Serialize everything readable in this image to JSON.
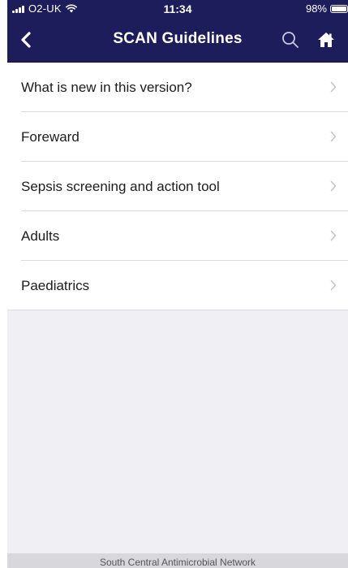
{
  "status_bar": {
    "carrier": "O2-UK",
    "time": "11:34",
    "battery_percent": "98%",
    "battery_level": 0.98
  },
  "nav": {
    "title": "SCAN Guidelines",
    "back_icon": "chevron-left-icon",
    "search_icon": "search-icon",
    "home_icon": "home-icon"
  },
  "menu": {
    "items": [
      {
        "label": "What is new in this version?"
      },
      {
        "label": "Foreward"
      },
      {
        "label": "Sepsis screening and action tool"
      },
      {
        "label": "Adults"
      },
      {
        "label": "Paediatrics"
      }
    ]
  },
  "footer": {
    "text": "South Central Antimicrobial Network"
  },
  "colors": {
    "nav_background": "#1d1d5c",
    "page_background": "#efeff4",
    "footer_background": "#d7d7dc"
  }
}
